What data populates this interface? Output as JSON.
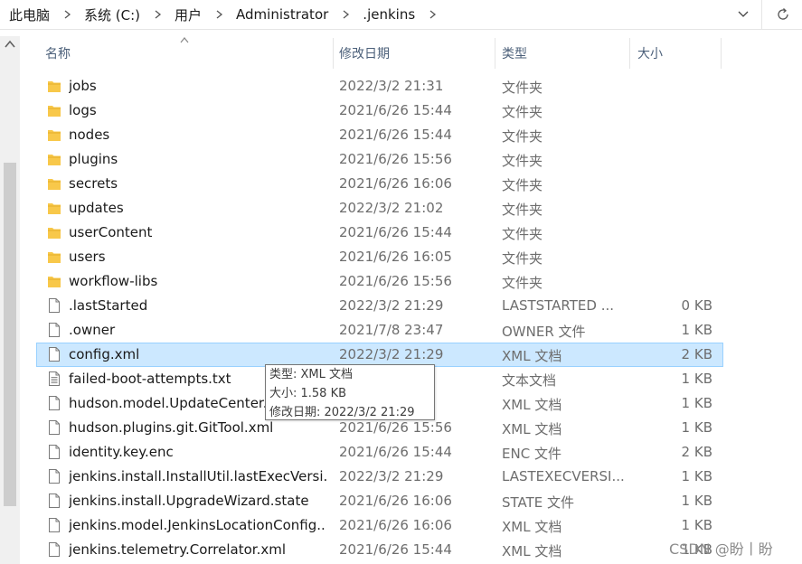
{
  "address": {
    "crumbs": [
      "此电脑",
      "系统 (C:)",
      "用户",
      "Administrator",
      ".jenkins"
    ]
  },
  "columns": {
    "name": "名称",
    "date": "修改日期",
    "type": "类型",
    "size": "大小"
  },
  "files": [
    {
      "name": "jobs",
      "date": "2022/3/2 21:31",
      "type": "文件夹",
      "size": "",
      "icon": "folder-icon"
    },
    {
      "name": "logs",
      "date": "2021/6/26 15:44",
      "type": "文件夹",
      "size": "",
      "icon": "folder-icon"
    },
    {
      "name": "nodes",
      "date": "2021/6/26 15:44",
      "type": "文件夹",
      "size": "",
      "icon": "folder-icon"
    },
    {
      "name": "plugins",
      "date": "2021/6/26 15:56",
      "type": "文件夹",
      "size": "",
      "icon": "folder-icon"
    },
    {
      "name": "secrets",
      "date": "2021/6/26 16:06",
      "type": "文件夹",
      "size": "",
      "icon": "folder-icon"
    },
    {
      "name": "updates",
      "date": "2022/3/2 21:02",
      "type": "文件夹",
      "size": "",
      "icon": "folder-icon"
    },
    {
      "name": "userContent",
      "date": "2021/6/26 15:44",
      "type": "文件夹",
      "size": "",
      "icon": "folder-icon"
    },
    {
      "name": "users",
      "date": "2021/6/26 16:05",
      "type": "文件夹",
      "size": "",
      "icon": "folder-icon"
    },
    {
      "name": "workflow-libs",
      "date": "2021/6/26 15:56",
      "type": "文件夹",
      "size": "",
      "icon": "folder-icon"
    },
    {
      "name": ".lastStarted",
      "date": "2022/3/2 21:29",
      "type": "LASTSTARTED ...",
      "size": "0 KB",
      "icon": "file-icon"
    },
    {
      "name": ".owner",
      "date": "2021/7/8 23:47",
      "type": "OWNER 文件",
      "size": "1 KB",
      "icon": "file-icon"
    },
    {
      "name": "config.xml",
      "date": "2022/3/2 21:29",
      "type": "XML 文档",
      "size": "2 KB",
      "icon": "file-icon",
      "selected": true
    },
    {
      "name": "failed-boot-attempts.txt",
      "date": "",
      "type": "文本文档",
      "size": "1 KB",
      "icon": "text-file-icon"
    },
    {
      "name": "hudson.model.UpdateCenter....",
      "date": "",
      "type": "XML 文档",
      "size": "1 KB",
      "icon": "file-icon"
    },
    {
      "name": "hudson.plugins.git.GitTool.xml",
      "date": "2021/6/26 15:56",
      "type": "XML 文档",
      "size": "1 KB",
      "icon": "file-icon"
    },
    {
      "name": "identity.key.enc",
      "date": "2021/6/26 15:44",
      "type": "ENC 文件",
      "size": "2 KB",
      "icon": "file-icon"
    },
    {
      "name": "jenkins.install.InstallUtil.lastExecVersi...",
      "date": "2022/3/2 21:29",
      "type": "LASTEXECVERSI...",
      "size": "1 KB",
      "icon": "file-icon"
    },
    {
      "name": "jenkins.install.UpgradeWizard.state",
      "date": "2021/6/26 16:06",
      "type": "STATE 文件",
      "size": "1 KB",
      "icon": "file-icon"
    },
    {
      "name": "jenkins.model.JenkinsLocationConfig...",
      "date": "2021/6/26 16:06",
      "type": "XML 文档",
      "size": "1 KB",
      "icon": "file-icon"
    },
    {
      "name": "jenkins.telemetry.Correlator.xml",
      "date": "2021/6/26 15:44",
      "type": "XML 文档",
      "size": "1 KB",
      "icon": "file-icon"
    }
  ],
  "tooltip": {
    "type_line": "类型: XML 文档",
    "size_line": "大小: 1.58 KB",
    "date_line": "修改日期: 2022/3/2 21:29"
  },
  "watermark": "CSDN @盼丨盼",
  "colors": {
    "folder": "#f8c84a",
    "selection_bg": "#cce8ff",
    "selection_border": "#99d1ff",
    "header_text": "#4c607a"
  }
}
